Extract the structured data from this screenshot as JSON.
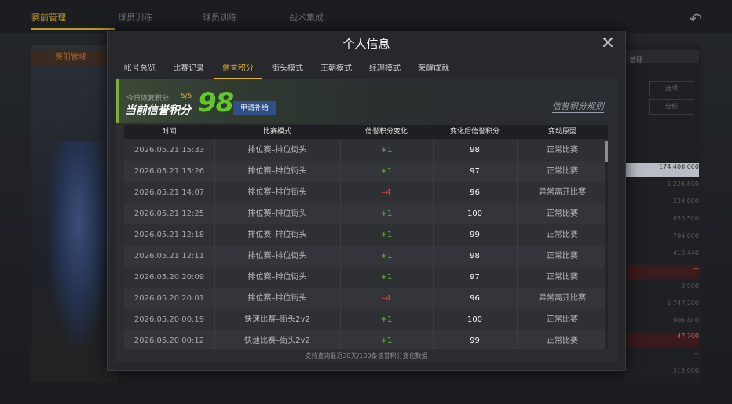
{
  "background": {
    "tabs": [
      "赛前管理",
      "球员训练",
      "球员训练",
      "战术集成"
    ],
    "left_tab": "赛前管理",
    "right_header": "管理",
    "right_buttons": [
      "选项",
      "分析"
    ],
    "right_values": [
      "一",
      "174,400,000",
      "1,226,800",
      "324,000",
      "853,500",
      "704,000",
      "413,440",
      "一",
      "3,900",
      "5,747,200",
      "906,400",
      "47,700",
      "一",
      "315,000"
    ]
  },
  "modal": {
    "title": "个人信息",
    "close_icon": "close-icon",
    "tabs": [
      {
        "label": "帐号总览"
      },
      {
        "label": "比赛记录"
      },
      {
        "label": "信誉积分"
      },
      {
        "label": "街头模式"
      },
      {
        "label": "王朝模式"
      },
      {
        "label": "经理模式"
      },
      {
        "label": "荣耀成就"
      }
    ],
    "active_tab": "信誉积分"
  },
  "credit": {
    "recover_label": "今日恢复积分",
    "recover_count": "5/5",
    "current_label": "当前信誉积分",
    "score": "98",
    "apply_button": "申请补给",
    "rules_link": "信誉积分规则"
  },
  "table": {
    "headers": [
      "时间",
      "比赛模式",
      "信誉积分变化",
      "变化后信誉积分",
      "变动原因"
    ],
    "rows": [
      {
        "time": "2026.05.21  15:33",
        "mode": "排位赛–排位街头",
        "change": "+1",
        "after": "98",
        "reason": "正常比赛"
      },
      {
        "time": "2026.05.21  15:26",
        "mode": "排位赛–排位街头",
        "change": "+1",
        "after": "97",
        "reason": "正常比赛"
      },
      {
        "time": "2026.05.21  14:07",
        "mode": "排位赛–排位街头",
        "change": "–4",
        "after": "96",
        "reason": "异常离开比赛"
      },
      {
        "time": "2026.05.21  12:25",
        "mode": "排位赛–排位街头",
        "change": "+1",
        "after": "100",
        "reason": "正常比赛"
      },
      {
        "time": "2026.05.21  12:18",
        "mode": "排位赛–排位街头",
        "change": "+1",
        "after": "99",
        "reason": "正常比赛"
      },
      {
        "time": "2026.05.21  12:11",
        "mode": "排位赛–排位街头",
        "change": "+1",
        "after": "98",
        "reason": "正常比赛"
      },
      {
        "time": "2026.05.20  20:09",
        "mode": "排位赛–排位街头",
        "change": "+1",
        "after": "97",
        "reason": "正常比赛"
      },
      {
        "time": "2026.05.20  20:01",
        "mode": "排位赛–排位街头",
        "change": "–4",
        "after": "96",
        "reason": "异常离开比赛"
      },
      {
        "time": "2026.05.20  00:19",
        "mode": "快速比赛–街头2v2",
        "change": "+1",
        "after": "100",
        "reason": "正常比赛"
      },
      {
        "time": "2026.05.20  00:12",
        "mode": "快速比赛–街头2v2",
        "change": "+1",
        "after": "99",
        "reason": "正常比赛"
      }
    ],
    "footer_note": "支持查询最近30天/100条信誉积分变化数据"
  },
  "colors": {
    "accent": "#e0b52f",
    "positive": "#5fc92c",
    "negative": "#e0463a",
    "button": "#2f4f86"
  }
}
